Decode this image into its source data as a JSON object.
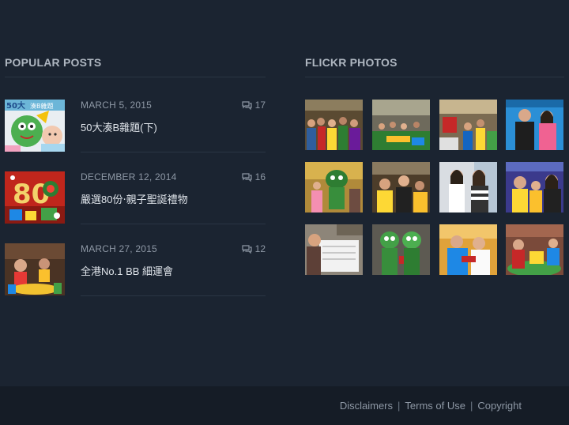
{
  "popular_posts": {
    "title": "POPULAR POSTS",
    "posts": [
      {
        "date": "MARCH 5, 2015",
        "comments": "17",
        "title": "50大湊B雜題(下)"
      },
      {
        "date": "DECEMBER 12, 2014",
        "comments": "16",
        "title": "嚴選80份‧親子聖誕禮物"
      },
      {
        "date": "MARCH 27, 2015",
        "comments": "12",
        "title": "全港No.1 BB 細運會"
      }
    ],
    "thumb_texts": [
      "50大",
      "湊B雜題",
      "80"
    ]
  },
  "flickr": {
    "title": "FLICKR PHOTOS",
    "photo_count": 12
  },
  "footer": {
    "links": [
      "Disclaimers",
      "Terms of Use",
      "Copyright"
    ],
    "separator": "|"
  },
  "colors": {
    "background": "#1b2431",
    "footer_background": "#151c26",
    "heading": "#aeb6c0",
    "muted_text": "#8e98a5",
    "post_title": "#dfe4ea",
    "divider": "#2a3544"
  }
}
